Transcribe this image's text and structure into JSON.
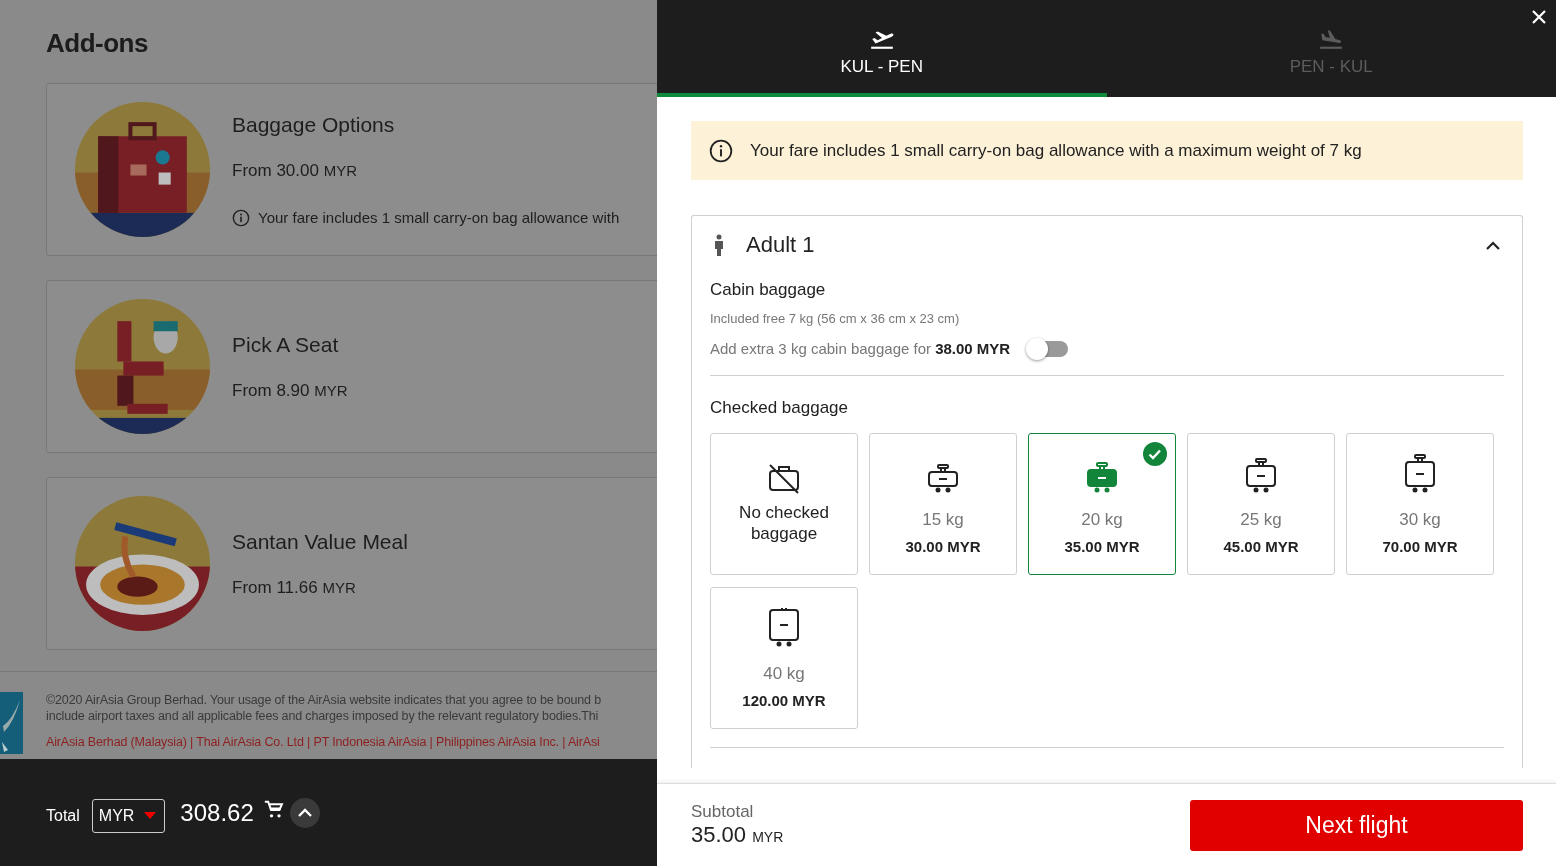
{
  "addons_page": {
    "title": "Add-ons",
    "cards": [
      {
        "kind": "baggage",
        "title": "Baggage Options",
        "price": "From 30.00",
        "currency": "MYR",
        "note": "Your fare includes 1 small carry-on bag allowance with"
      },
      {
        "kind": "seat",
        "title": "Pick A Seat",
        "price": "From 8.90",
        "currency": "MYR"
      },
      {
        "kind": "meal",
        "title": "Santan Value Meal",
        "price": "From 11.66",
        "currency": "MYR"
      }
    ],
    "footer": {
      "copyright": "©2020 AirAsia Group Berhad. Your usage of the AirAsia website indicates that you agree to be bound b",
      "fine_print": "include airport taxes and all applicable fees and charges imposed by the relevant regulatory bodies.Thi",
      "links": "AirAsia Berhad (Malaysia) | Thai AirAsia Co. Ltd | PT Indonesia AirAsia | Philippines AirAsia Inc. | AirAsi"
    },
    "total_bar": {
      "label": "Total",
      "currency": "MYR",
      "amount": "308.62"
    }
  },
  "drawer": {
    "tabs": [
      {
        "kind": "depart",
        "label": "KUL - PEN",
        "selected": true
      },
      {
        "kind": "arrive",
        "label": "PEN - KUL",
        "selected": false
      }
    ],
    "notice": "Your fare includes 1 small carry-on bag allowance with a maximum weight of 7 kg",
    "passenger": {
      "name": "Adult 1",
      "expanded": true,
      "cabin": {
        "title": "Cabin baggage",
        "included": "Included free 7 kg (56 cm x 36 cm x 23 cm)",
        "extra_label": "Add extra 3 kg cabin baggage for **38.00 MYR**",
        "extra_on": false
      },
      "checked": {
        "title": "Checked baggage",
        "options": [
          {
            "kind": "none",
            "label": "No checked baggage",
            "selected": false
          },
          {
            "kind": "weight",
            "weight": "15 kg",
            "price": "30.00 MYR",
            "selected": false
          },
          {
            "kind": "weight",
            "weight": "20 kg",
            "price": "35.00 MYR",
            "selected": true
          },
          {
            "kind": "weight",
            "weight": "25 kg",
            "price": "45.00 MYR",
            "selected": false
          },
          {
            "kind": "weight",
            "weight": "30 kg",
            "price": "70.00 MYR",
            "selected": false
          },
          {
            "kind": "weight",
            "weight": "40 kg",
            "price": "120.00 MYR",
            "selected": false
          }
        ]
      }
    },
    "subtotal": {
      "label": "Subtotal",
      "amount": "35.00",
      "currency": "MYR"
    },
    "next_button": "Next flight"
  }
}
